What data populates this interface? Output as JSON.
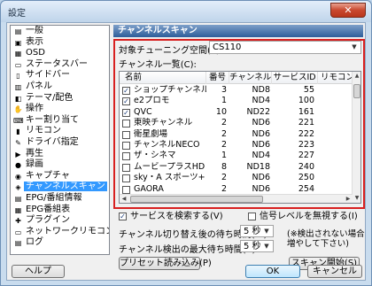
{
  "window": {
    "title": "設定",
    "close_glyph": "✕"
  },
  "tree": {
    "items": [
      {
        "label": "一般",
        "icon": "general-icon",
        "glyph": "▤"
      },
      {
        "label": "表示",
        "icon": "display-icon",
        "glyph": "▣"
      },
      {
        "label": "OSD",
        "icon": "osd-icon",
        "glyph": "▦"
      },
      {
        "label": "ステータスバー",
        "icon": "statusbar-icon",
        "glyph": "▭"
      },
      {
        "label": "サイドバー",
        "icon": "sidebar-icon",
        "glyph": "▯"
      },
      {
        "label": "パネル",
        "icon": "panel-icon",
        "glyph": "▥"
      },
      {
        "label": "テーマ/配色",
        "icon": "theme-icon",
        "glyph": "◧"
      },
      {
        "label": "操作",
        "icon": "operation-icon",
        "glyph": "✋"
      },
      {
        "label": "キー割り当て",
        "icon": "keyboard-icon",
        "glyph": "⌨"
      },
      {
        "label": "リモコン",
        "icon": "remote-icon",
        "glyph": "▮"
      },
      {
        "label": "ドライバ指定",
        "icon": "driver-icon",
        "glyph": "✎"
      },
      {
        "label": "再生",
        "icon": "play-icon",
        "glyph": "▶"
      },
      {
        "label": "録画",
        "icon": "record-icon",
        "glyph": "●"
      },
      {
        "label": "キャプチャ",
        "icon": "capture-icon",
        "glyph": "◉"
      },
      {
        "label": "チャンネルスキャン",
        "icon": "channel-scan-icon",
        "glyph": "◈",
        "selected": true
      },
      {
        "label": "EPG/番組情報",
        "icon": "epg-icon",
        "glyph": "▤"
      },
      {
        "label": "EPG番組表",
        "icon": "epg-table-icon",
        "glyph": "▦"
      },
      {
        "label": "プラグイン",
        "icon": "plugin-icon",
        "glyph": "✚"
      },
      {
        "label": "ネットワークリモコン",
        "icon": "network-remote-icon",
        "glyph": "▭"
      },
      {
        "label": "ログ",
        "icon": "log-icon",
        "glyph": "▤"
      }
    ]
  },
  "panel": {
    "title": "チャンネルスキャン",
    "tuning_space_label": "対象チューニング空間(T):",
    "tuning_space_value": "CS110",
    "channel_list_label": "チャンネル一覧(C):",
    "columns": [
      "名前",
      "番号",
      "チャンネル",
      "サービスID",
      "リモコンキー"
    ],
    "rows": [
      {
        "checked": true,
        "name": "ショップチャンネル",
        "number": "3",
        "channel": "ND8",
        "service_id": "55"
      },
      {
        "checked": true,
        "name": "e2プロモ",
        "number": "1",
        "channel": "ND4",
        "service_id": "100"
      },
      {
        "checked": true,
        "name": "QVC",
        "number": "10",
        "channel": "ND22",
        "service_id": "161"
      },
      {
        "checked": false,
        "name": "東映チャンネル",
        "number": "2",
        "channel": "ND6",
        "service_id": "221"
      },
      {
        "checked": false,
        "name": "衛星劇場",
        "number": "2",
        "channel": "ND6",
        "service_id": "222"
      },
      {
        "checked": false,
        "name": "チャンネルNECO",
        "number": "2",
        "channel": "ND6",
        "service_id": "223"
      },
      {
        "checked": false,
        "name": "ザ・シネマ",
        "number": "1",
        "channel": "ND4",
        "service_id": "227"
      },
      {
        "checked": false,
        "name": "ムービープラスHD",
        "number": "8",
        "channel": "ND18",
        "service_id": "240"
      },
      {
        "checked": false,
        "name": "sky・A スポーツ+",
        "number": "2",
        "channel": "ND6",
        "service_id": "250"
      },
      {
        "checked": false,
        "name": "GAORA",
        "number": "2",
        "channel": "ND6",
        "service_id": "254"
      }
    ],
    "search_services_label": "サービスを検索する(V)",
    "search_services_checked": true,
    "ignore_signal_label": "信号レベルを無視する(I)",
    "ignore_signal_checked": false,
    "wait_label": "チャンネル切り替え後の待ち時間(W):",
    "wait_value": "5 秒",
    "max_wait_label": "チャンネル検出の最大待ち時間(R):",
    "max_wait_value": "5 秒",
    "note_line1": "(※検出されない場合",
    "note_line2": "増やして下さい)",
    "preset_button": "プリセット読み込み(P)",
    "scan_button": "スキャン開始(S)"
  },
  "footer": {
    "help_button": "ヘルプ",
    "ok_button": "OK",
    "cancel_button": "キャンセル"
  },
  "colors": {
    "highlight": "#d82020",
    "selection": "#3399ff",
    "header": "#2d5d9a"
  }
}
